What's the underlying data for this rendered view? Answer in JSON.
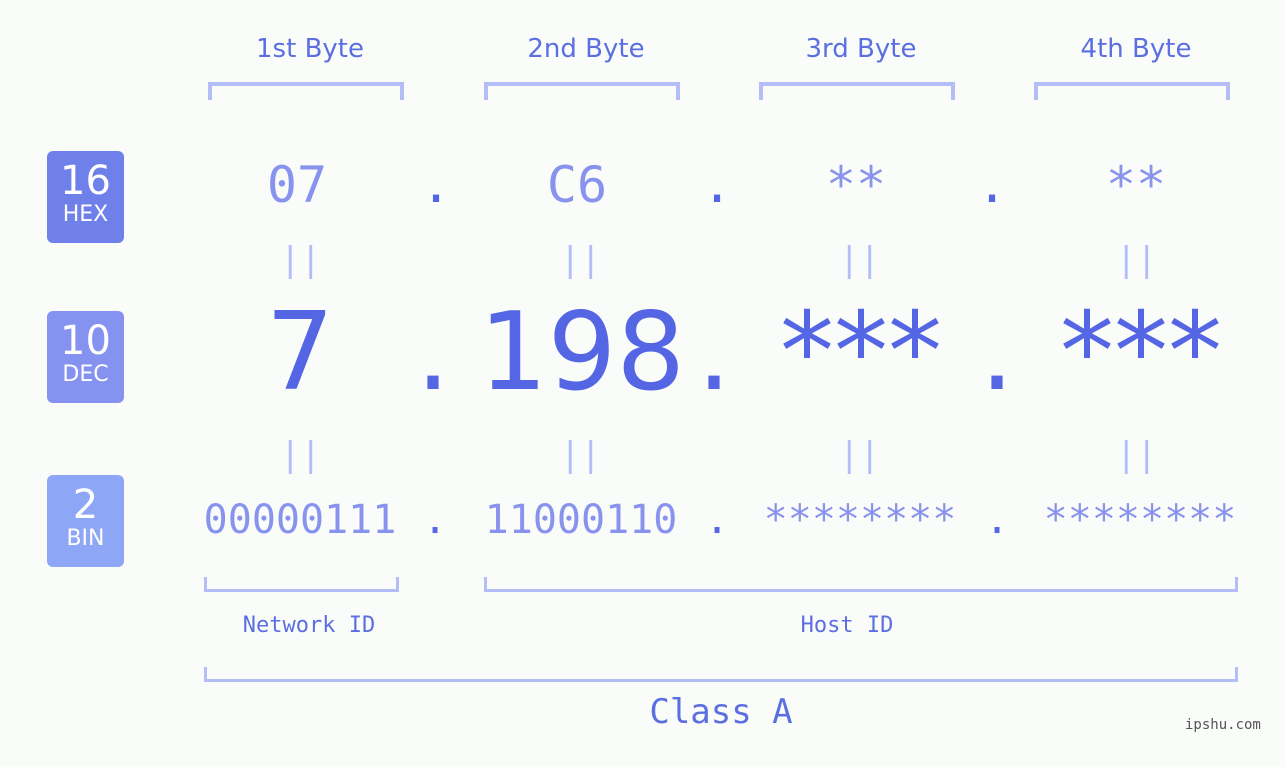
{
  "bytes": [
    {
      "label": "1st Byte",
      "hex": "07",
      "dec": "7",
      "bin": "00000111"
    },
    {
      "label": "2nd Byte",
      "hex": "C6",
      "dec": "198",
      "bin": "11000110"
    },
    {
      "label": "3rd Byte",
      "hex": "**",
      "dec": "***",
      "bin": "********"
    },
    {
      "label": "4th Byte",
      "hex": "**",
      "dec": "***",
      "bin": "********"
    }
  ],
  "badges": {
    "hex": {
      "num": "16",
      "label": "HEX",
      "color": "#7080ea"
    },
    "dec": {
      "num": "10",
      "label": "DEC",
      "color": "#8592f0"
    },
    "bin": {
      "num": "2",
      "label": "BIN",
      "color": "#8ea6f6"
    }
  },
  "separator": ".",
  "equals": "||",
  "network_id_label": "Network ID",
  "host_id_label": "Host ID",
  "class_label": "Class A",
  "watermark": "ipshu.com"
}
